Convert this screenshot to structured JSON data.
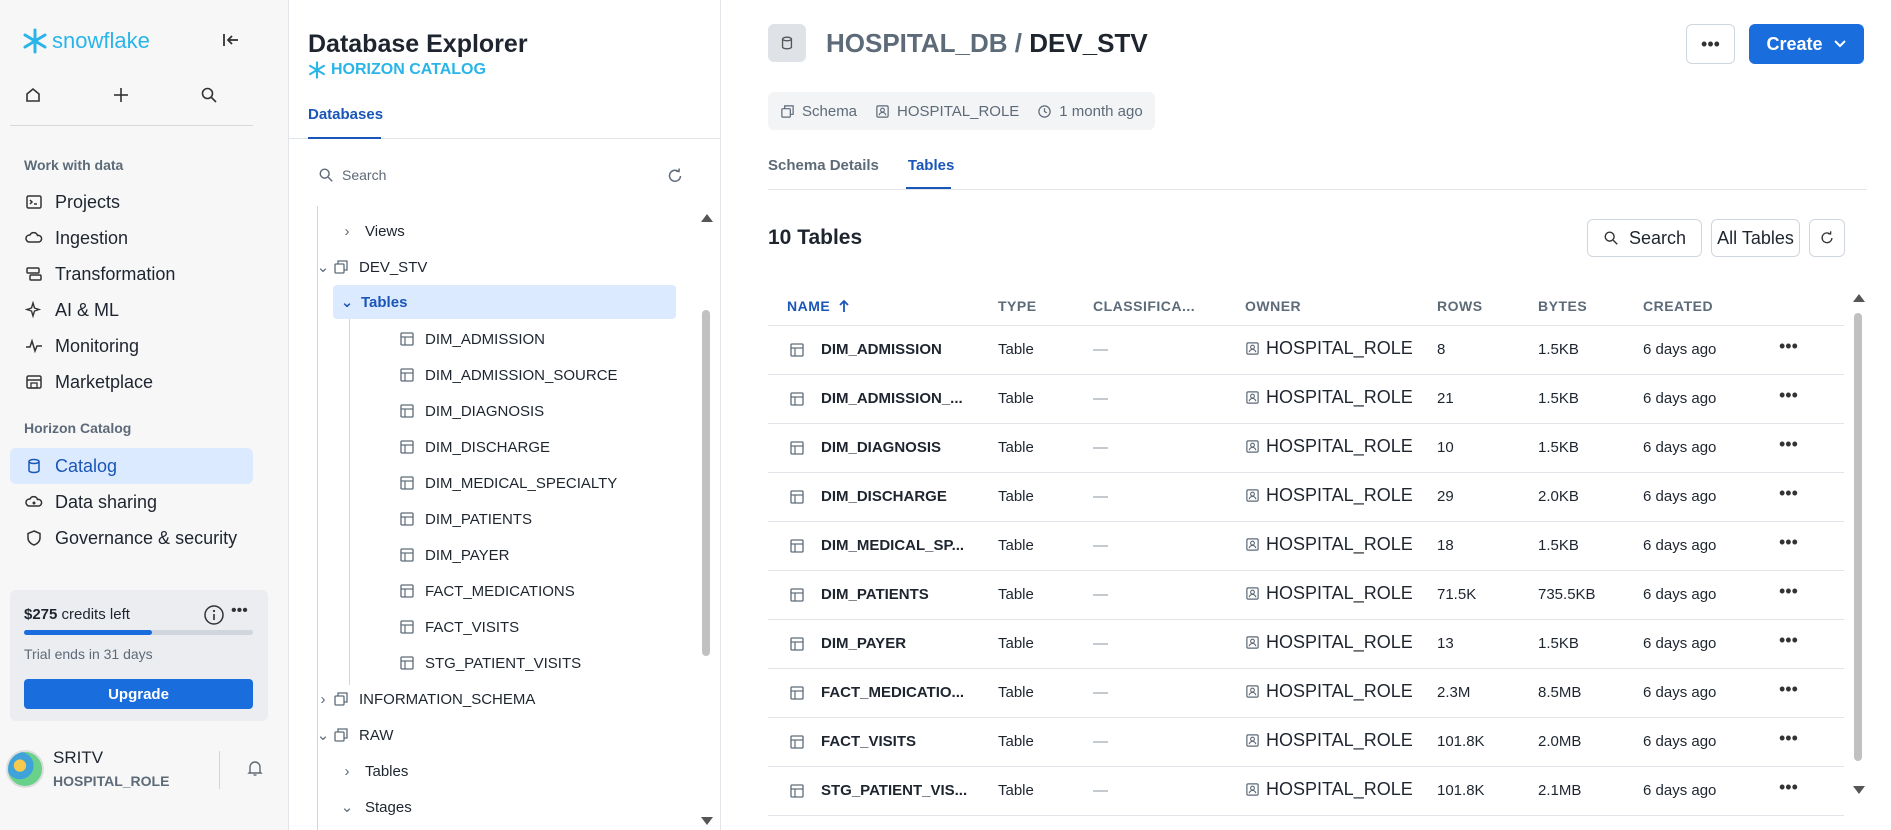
{
  "brand": {
    "name": "snowflake"
  },
  "nav": {
    "section1": "Work with data",
    "items1": [
      {
        "label": "Projects",
        "icon": "terminal-icon"
      },
      {
        "label": "Ingestion",
        "icon": "cloud-icon"
      },
      {
        "label": "Transformation",
        "icon": "stack-icon"
      },
      {
        "label": "AI & ML",
        "icon": "sparkle-icon"
      },
      {
        "label": "Monitoring",
        "icon": "pulse-icon"
      },
      {
        "label": "Marketplace",
        "icon": "store-icon"
      }
    ],
    "section2": "Horizon Catalog",
    "items2": [
      {
        "label": "Catalog",
        "icon": "database-icon",
        "active": true
      },
      {
        "label": "Data sharing",
        "icon": "share-cloud-icon"
      },
      {
        "label": "Governance & security",
        "icon": "shield-icon"
      }
    ],
    "credits": {
      "amount": "$275",
      "suffix": "credits left",
      "trial": "Trial ends in 31 days",
      "upgrade": "Upgrade",
      "progress": 0.56
    },
    "user": {
      "name": "SRITV",
      "role": "HOSPITAL_ROLE"
    }
  },
  "explorer": {
    "title": "Database Explorer",
    "subtitle": "HORIZON CATALOG",
    "tab": "Databases",
    "search_placeholder": "Search",
    "tree": {
      "views": "Views",
      "dev_stv": "DEV_STV",
      "tables": "Tables",
      "table_items": [
        "DIM_ADMISSION",
        "DIM_ADMISSION_SOURCE",
        "DIM_DIAGNOSIS",
        "DIM_DISCHARGE",
        "DIM_MEDICAL_SPECIALTY",
        "DIM_PATIENTS",
        "DIM_PAYER",
        "FACT_MEDICATIONS",
        "FACT_VISITS",
        "STG_PATIENT_VISITS"
      ],
      "information_schema": "INFORMATION_SCHEMA",
      "raw": "RAW",
      "raw_tables": "Tables",
      "raw_stages": "Stages"
    }
  },
  "main": {
    "breadcrumb_db": "HOSPITAL_DB",
    "breadcrumb_sep": "/",
    "breadcrumb_schema": "DEV_STV",
    "create": "Create",
    "meta": {
      "type": "Schema",
      "owner": "HOSPITAL_ROLE",
      "time": "1 month ago"
    },
    "tabs": [
      "Schema Details",
      "Tables"
    ],
    "count": "10 Tables",
    "search": "Search",
    "filter": "All Tables",
    "columns": [
      "NAME",
      "TYPE",
      "CLASSIFICA...",
      "OWNER",
      "ROWS",
      "BYTES",
      "CREATED"
    ],
    "rows": [
      {
        "name": "DIM_ADMISSION",
        "type": "Table",
        "class": "—",
        "owner": "HOSPITAL_ROLE",
        "rows": "8",
        "bytes": "1.5KB",
        "created": "6 days ago"
      },
      {
        "name": "DIM_ADMISSION_...",
        "type": "Table",
        "class": "—",
        "owner": "HOSPITAL_ROLE",
        "rows": "21",
        "bytes": "1.5KB",
        "created": "6 days ago"
      },
      {
        "name": "DIM_DIAGNOSIS",
        "type": "Table",
        "class": "—",
        "owner": "HOSPITAL_ROLE",
        "rows": "10",
        "bytes": "1.5KB",
        "created": "6 days ago"
      },
      {
        "name": "DIM_DISCHARGE",
        "type": "Table",
        "class": "—",
        "owner": "HOSPITAL_ROLE",
        "rows": "29",
        "bytes": "2.0KB",
        "created": "6 days ago"
      },
      {
        "name": "DIM_MEDICAL_SP...",
        "type": "Table",
        "class": "—",
        "owner": "HOSPITAL_ROLE",
        "rows": "18",
        "bytes": "1.5KB",
        "created": "6 days ago"
      },
      {
        "name": "DIM_PATIENTS",
        "type": "Table",
        "class": "—",
        "owner": "HOSPITAL_ROLE",
        "rows": "71.5K",
        "bytes": "735.5KB",
        "created": "6 days ago"
      },
      {
        "name": "DIM_PAYER",
        "type": "Table",
        "class": "—",
        "owner": "HOSPITAL_ROLE",
        "rows": "13",
        "bytes": "1.5KB",
        "created": "6 days ago"
      },
      {
        "name": "FACT_MEDICATIO...",
        "type": "Table",
        "class": "—",
        "owner": "HOSPITAL_ROLE",
        "rows": "2.3M",
        "bytes": "8.5MB",
        "created": "6 days ago"
      },
      {
        "name": "FACT_VISITS",
        "type": "Table",
        "class": "—",
        "owner": "HOSPITAL_ROLE",
        "rows": "101.8K",
        "bytes": "2.0MB",
        "created": "6 days ago"
      },
      {
        "name": "STG_PATIENT_VIS...",
        "type": "Table",
        "class": "—",
        "owner": "HOSPITAL_ROLE",
        "rows": "101.8K",
        "bytes": "2.1MB",
        "created": "6 days ago"
      }
    ]
  }
}
